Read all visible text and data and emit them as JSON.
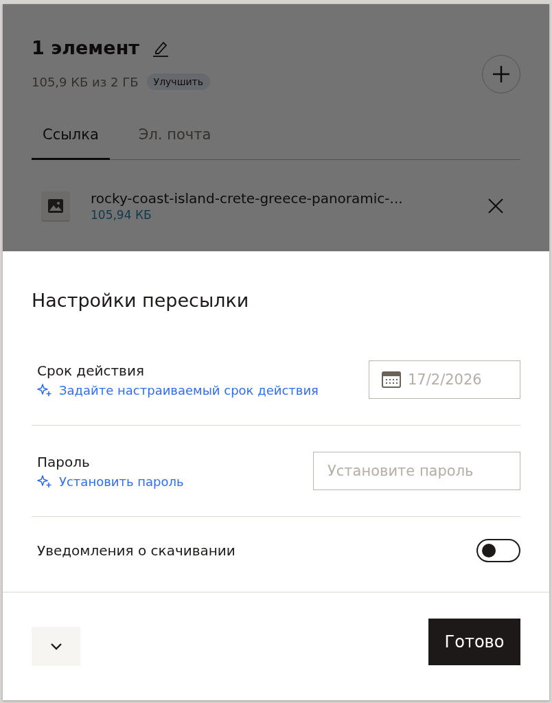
{
  "header": {
    "title": "1 элемент",
    "storage": "105,9 КБ из 2 ГБ",
    "upgrade": "Улучшить"
  },
  "tabs": [
    {
      "label": "Ссылка",
      "selected": true
    },
    {
      "label": "Эл. почта",
      "selected": false
    }
  ],
  "files": [
    {
      "name": "rocky-coast-island-crete-greece-panoramic-...",
      "size": "105,94 КБ"
    }
  ],
  "settings": {
    "title": "Настройки пересылки",
    "rows": [
      {
        "kind": "date",
        "label": "Срок действия",
        "link": "Задайте настраиваемый срок действия",
        "placeholder": "17/2/2026"
      },
      {
        "kind": "text",
        "label": "Пароль",
        "link": "Установить пароль",
        "placeholder": "Установите пароль"
      },
      {
        "kind": "toggle",
        "label": "Уведомления о скачивании",
        "on": false
      }
    ]
  },
  "footer": {
    "done": "Готово"
  }
}
